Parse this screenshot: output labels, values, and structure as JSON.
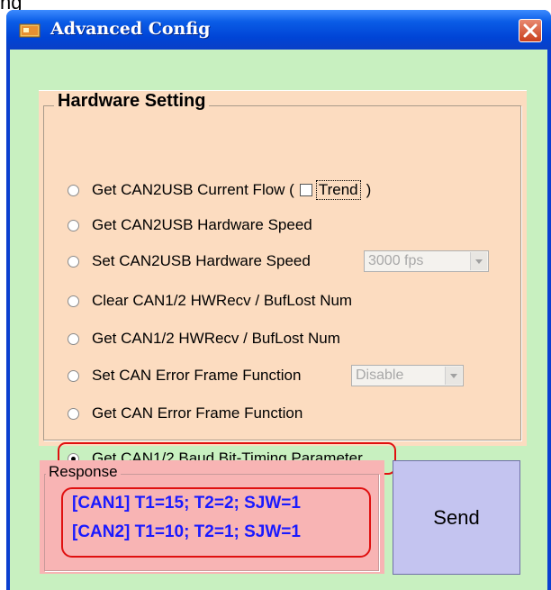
{
  "top_strip_text": "ng",
  "window": {
    "title": "Advanced Config"
  },
  "hardware": {
    "title": "Hardware Setting",
    "options": [
      {
        "label": "Get CAN2USB Current Flow  (",
        "checked": false
      },
      {
        "label": "Get CAN2USB Hardware Speed",
        "checked": false
      },
      {
        "label": "Set CAN2USB Hardware Speed",
        "checked": false
      },
      {
        "label": "Clear CAN1/2 HWRecv / BufLost Num",
        "checked": false
      },
      {
        "label": "Get CAN1/2 HWRecv / BufLost Num",
        "checked": false
      },
      {
        "label": "Set CAN Error Frame Function",
        "checked": false
      },
      {
        "label": "Get CAN Error Frame Function",
        "checked": false
      },
      {
        "label": "Get CAN1/2 Baud Bit-Timing Parameter",
        "checked": true
      }
    ],
    "trend_label": "Trend",
    "trend_close": ")",
    "speed_combo_value": "3000 fps",
    "error_combo_value": "Disable"
  },
  "response": {
    "title": "Response",
    "line1": "[CAN1] T1=15; T2=2; SJW=1",
    "line2": "[CAN2] T1=10; T2=1; SJW=1"
  },
  "send_label": "Send",
  "colors": {
    "client_bg": "#c8f0c0",
    "hardware_bg": "#fcdcc0",
    "response_bg": "#f8b4b4",
    "send_bg": "#c4c4f0",
    "highlight": "#e01010",
    "response_text": "#1a1aff"
  }
}
